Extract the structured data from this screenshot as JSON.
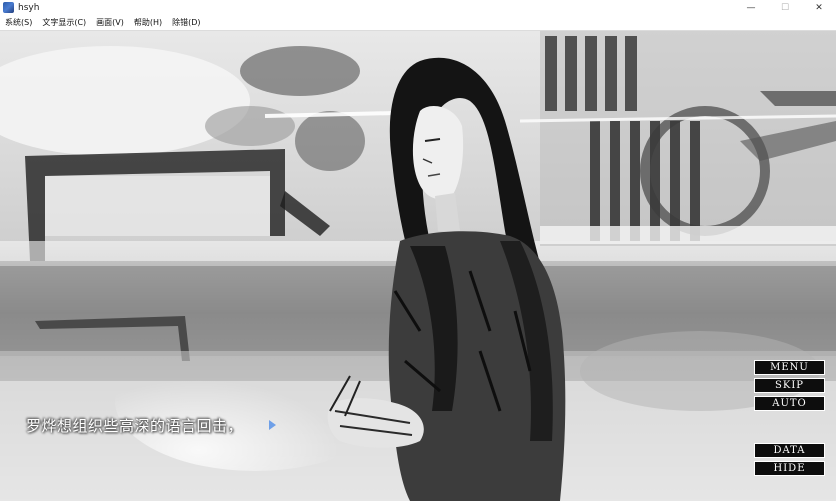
{
  "window": {
    "title": "hsyh",
    "controls": {
      "minimize": "—",
      "maximize": "☐",
      "close": "✕"
    }
  },
  "menubar": {
    "items": [
      {
        "label": "系统(S)"
      },
      {
        "label": "文字显示(C)"
      },
      {
        "label": "画面(V)"
      },
      {
        "label": "帮助(H)"
      },
      {
        "label": "除错(D)"
      }
    ]
  },
  "scene": {
    "dialogue": "罗烨想组织些高深的语言回击，"
  },
  "system_menu": {
    "menu": "MENU",
    "skip": "SKIP",
    "auto": "AUTO",
    "data": "DATA",
    "hide": "HIDE"
  },
  "colors": {
    "button_bg": "#0d0d0d",
    "button_text": "#ffffff",
    "next_arrow": "#6fa0e8"
  }
}
